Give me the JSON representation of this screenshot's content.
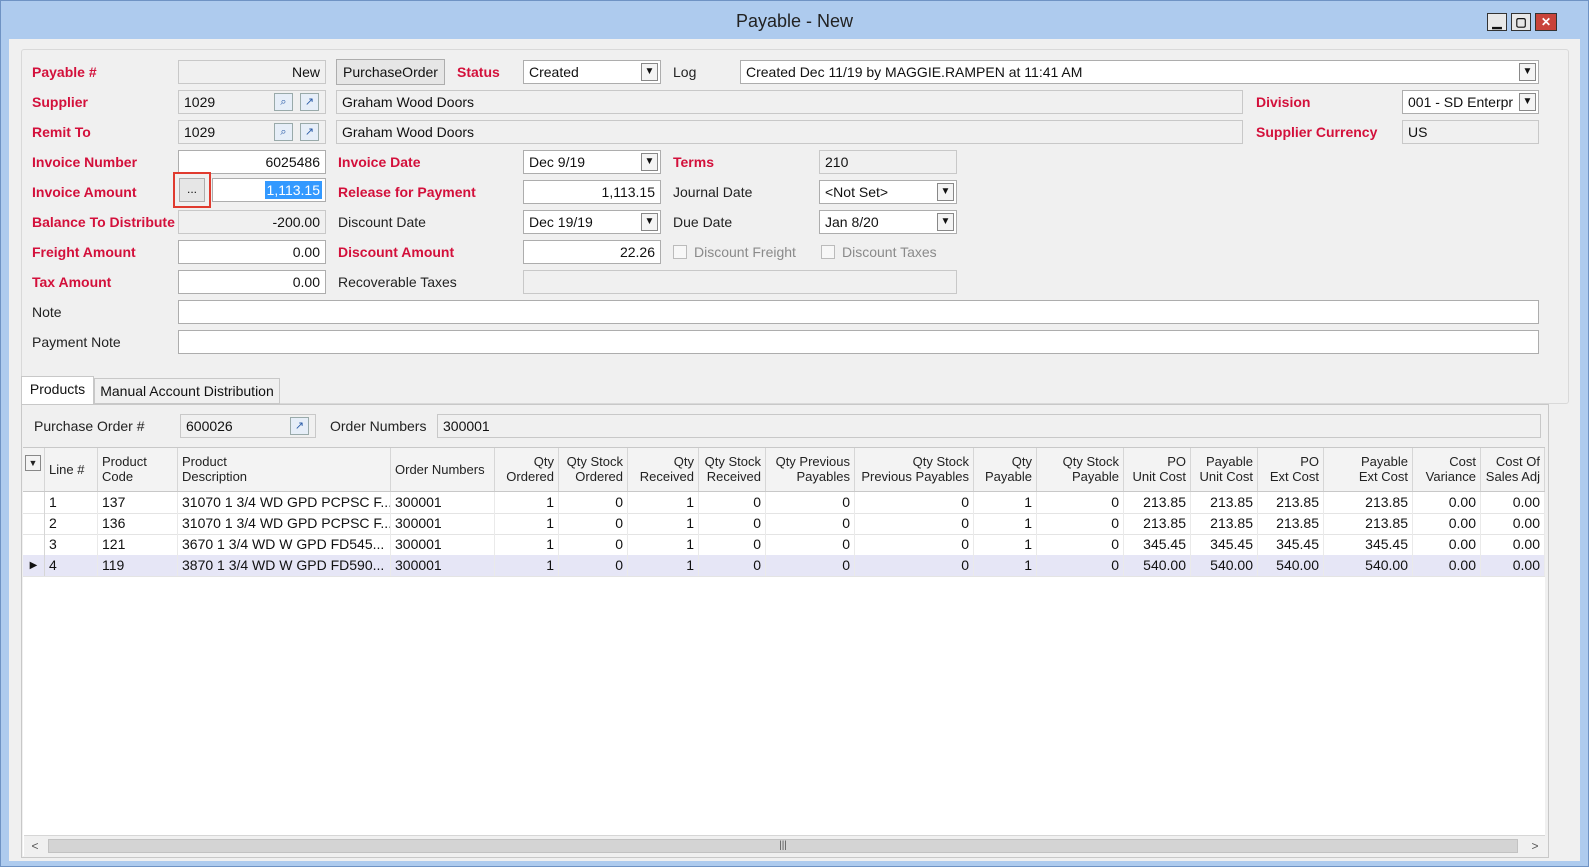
{
  "window": {
    "title": "Payable - New",
    "minimize": "▁",
    "maximize": "▢",
    "close": "✕"
  },
  "form": {
    "payable_num_label": "Payable #",
    "payable_num": "New",
    "purchase_order_button": "PurchaseOrder",
    "status_label": "Status",
    "status": "Created",
    "log_label": "Log",
    "log": "Created Dec 11/19 by MAGGIE.RAMPEN at 11:41 AM",
    "supplier_label": "Supplier",
    "supplier_code": "1029",
    "supplier_name": "Graham Wood Doors",
    "division_label": "Division",
    "division": "001 - SD Enterpr",
    "remit_to_label": "Remit To",
    "remit_code": "1029",
    "remit_name": "Graham Wood Doors",
    "supplier_currency_label": "Supplier Currency",
    "supplier_currency": "US",
    "invoice_number_label": "Invoice Number",
    "invoice_number": "6025486",
    "invoice_date_label": "Invoice Date",
    "invoice_date": "Dec 9/19",
    "terms_label": "Terms",
    "terms": "210",
    "invoice_amount_label": "Invoice Amount",
    "invoice_amount_button": "...",
    "invoice_amount": "1,113.15",
    "release_label": "Release for Payment",
    "release_amount": "1,113.15",
    "journal_date_label": "Journal Date",
    "journal_date": "<Not Set>",
    "balance_label": "Balance To Distribute",
    "balance": "-200.00",
    "discount_date_label": "Discount Date",
    "discount_date": "Dec 19/19",
    "due_date_label": "Due Date",
    "due_date": "Jan 8/20",
    "freight_label": "Freight Amount",
    "freight": "0.00",
    "discount_amount_label": "Discount Amount",
    "discount_amount": "22.26",
    "discount_freight_label": "Discount Freight",
    "discount_taxes_label": "Discount Taxes",
    "tax_label": "Tax Amount",
    "tax": "0.00",
    "recoverable_taxes_label": "Recoverable Taxes",
    "recoverable_taxes": "",
    "note_label": "Note",
    "note": "",
    "payment_note_label": "Payment Note",
    "payment_note": ""
  },
  "tabs": [
    {
      "label": "Products"
    },
    {
      "label": "Manual Account Distribution"
    }
  ],
  "products": {
    "po_label": "Purchase Order #",
    "po_number": "600026",
    "order_numbers_label": "Order Numbers",
    "order_numbers": "300001",
    "columns": [
      "Line #",
      "Product Code",
      "Product Description",
      "Order Numbers",
      "Qty Ordered",
      "Qty Stock Ordered",
      "Qty Received",
      "Qty Stock Received",
      "Qty Previous Payables",
      "Qty Stock Previous Payables",
      "Qty Payable",
      "Qty Stock Payable",
      "PO Unit Cost",
      "Payable Unit Cost",
      "PO Ext Cost",
      "Payable Ext Cost",
      "Cost Variance",
      "Cost Of Sales Adj"
    ],
    "columns_line1": [
      "",
      "Product",
      "Product",
      "",
      "Qty",
      "Qty Stock",
      "Qty",
      "Qty Stock",
      "Qty Previous",
      "Qty Stock",
      "Qty",
      "Qty Stock",
      "PO",
      "Payable",
      "PO",
      "Payable",
      "Cost",
      "Cost Of"
    ],
    "columns_line2": [
      "Line #",
      "Code",
      "Description",
      "Order Numbers",
      "Ordered",
      "Ordered",
      "Received",
      "Received",
      "Payables",
      "Previous Payables",
      "Payable",
      "Payable",
      "Unit Cost",
      "Unit Cost",
      "Ext Cost",
      "Ext Cost",
      "Variance",
      "Sales Adj"
    ],
    "rows": [
      [
        "1",
        "137",
        "31070 1 3/4 WD GPD PCPSC F...",
        "300001",
        "1",
        "0",
        "1",
        "0",
        "0",
        "0",
        "1",
        "0",
        "213.85",
        "213.85",
        "213.85",
        "213.85",
        "0.00",
        "0.00"
      ],
      [
        "2",
        "136",
        "31070 1 3/4 WD GPD PCPSC F...",
        "300001",
        "1",
        "0",
        "1",
        "0",
        "0",
        "0",
        "1",
        "0",
        "213.85",
        "213.85",
        "213.85",
        "213.85",
        "0.00",
        "0.00"
      ],
      [
        "3",
        "121",
        "3670 1 3/4 WD W GPD FD545...",
        "300001",
        "1",
        "0",
        "1",
        "0",
        "0",
        "0",
        "1",
        "0",
        "345.45",
        "345.45",
        "345.45",
        "345.45",
        "0.00",
        "0.00"
      ],
      [
        "4",
        "119",
        "3870 1 3/4 WD W GPD FD590...",
        "300001",
        "1",
        "0",
        "1",
        "0",
        "0",
        "0",
        "1",
        "0",
        "540.00",
        "540.00",
        "540.00",
        "540.00",
        "0.00",
        "0.00"
      ]
    ],
    "current_row_marker": "▶"
  },
  "colors": {
    "required_label": "#d3103b",
    "selection": "#3399ff",
    "highlight_box": "#e03b2f"
  }
}
